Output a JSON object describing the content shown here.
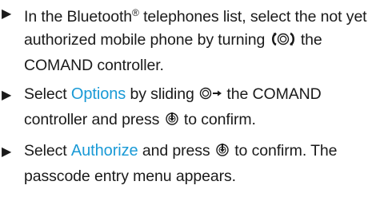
{
  "instructions": [
    {
      "text_before": "In the Bluetooth",
      "registered": "®",
      "text_after": " telephones list, select the not yet authorized mobile phone by turning ",
      "control_icon": "turn-controller-icon",
      "text_end": " the COMAND controller."
    },
    {
      "text_before": "Select ",
      "ui_label": "Options",
      "text_mid": " by sliding ",
      "control_icon": "slide-right-controller-icon",
      "text_mid2": " the COMAND controller and press ",
      "press_icon": "press-controller-icon",
      "text_end": " to confirm."
    },
    {
      "text_before": "Select ",
      "ui_label": "Authorize",
      "text_mid": " and press ",
      "press_icon": "press-controller-icon",
      "text_end": " to confirm. The passcode entry menu appears."
    }
  ],
  "colors": {
    "ui_label": "#1a9ad6",
    "text": "#1a1a1a"
  }
}
